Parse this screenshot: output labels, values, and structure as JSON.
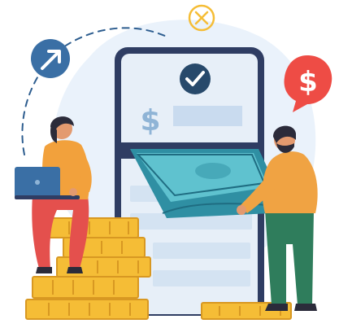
{
  "illustration": {
    "glyphs": {
      "screen_currency": "$",
      "bubble_currency": "$"
    },
    "icons": [
      "checkmark-icon",
      "arrow-up-right-icon",
      "close-icon",
      "dollar-icon",
      "laptop-icon"
    ],
    "colors": {
      "blob_background": "#eaf2fb",
      "phone_frame": "#2f3d63",
      "phone_screen": "#e7eff8",
      "screen_bar": "#c9dbef",
      "check_circle": "#27496b",
      "arrow_circle": "#3a6fa5",
      "dollar_bubble": "#ee4c45",
      "coin_gold": "#f5bd36",
      "coin_shadow": "#d89822",
      "banknote_dark": "#2f8fa3",
      "banknote_light": "#5fc2cf",
      "woman_shirt": "#f2a13c",
      "woman_pants": "#e4504d",
      "man_shirt": "#f0a343",
      "man_pants": "#2f7d5c",
      "hair": "#2b2b3a",
      "skin": "#e39a6f"
    }
  }
}
